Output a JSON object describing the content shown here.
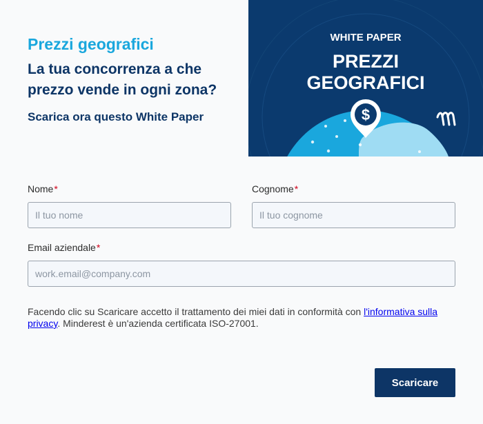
{
  "intro": {
    "eyebrow": "Prezzi geografici",
    "headline": "La tua concorrenza a che prezzo vende in ogni zona?",
    "cta": "Scarica ora questo White Paper"
  },
  "cover": {
    "kicker": "WHITE PAPER",
    "title_line1": "PREZZI",
    "title_line2": "GEOGRAFICI",
    "pin_symbol": "$",
    "logo_icon": "minderest-logo-icon",
    "colors": {
      "background": "#0b3a6e",
      "globe": "#1aa7dd",
      "globe_light": "#9fdcf3"
    }
  },
  "form": {
    "first_name": {
      "label": "Nome",
      "required_mark": "*",
      "placeholder": "Il tuo nome"
    },
    "last_name": {
      "label": "Cognome",
      "required_mark": "*",
      "placeholder": "Il tuo cognome"
    },
    "email": {
      "label": "Email aziendale",
      "required_mark": "*",
      "placeholder": "work.email@company.com"
    },
    "consent": {
      "before_link": "Facendo clic su Scaricare accetto il trattamento dei miei dati in conformità con ",
      "link_text": "l'informativa sulla privacy",
      "after_link": ". Minderest è un'azienda certificata ISO-27001."
    },
    "submit_label": "Scaricare"
  },
  "colors": {
    "brand_dark": "#0d3566",
    "brand_light": "#1aa7dd",
    "required": "#d0021b"
  }
}
